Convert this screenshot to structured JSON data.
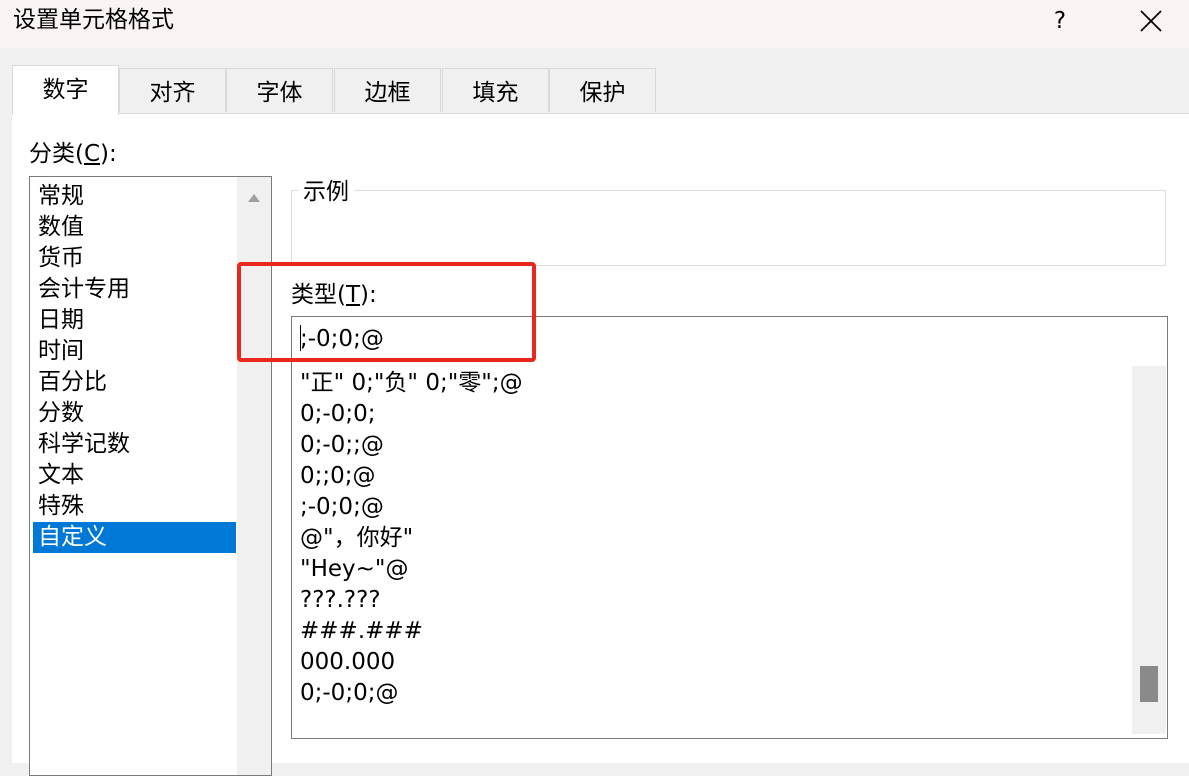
{
  "dialog": {
    "title": "设置单元格格式",
    "help_label": "?"
  },
  "tabs": [
    {
      "label": "数字",
      "active": true
    },
    {
      "label": "对齐",
      "active": false
    },
    {
      "label": "字体",
      "active": false
    },
    {
      "label": "边框",
      "active": false
    },
    {
      "label": "填充",
      "active": false
    },
    {
      "label": "保护",
      "active": false
    }
  ],
  "category": {
    "label_main": "分类(",
    "label_key": "C",
    "label_tail": "):",
    "items": [
      "常规",
      "数值",
      "货币",
      "会计专用",
      "日期",
      "时间",
      "百分比",
      "分数",
      "科学记数",
      "文本",
      "特殊",
      "自定义"
    ],
    "selected": "自定义"
  },
  "sample": {
    "title": "示例"
  },
  "type": {
    "label_main": "类型(",
    "label_key": "T",
    "label_tail": "):",
    "value": ";-0;0;@"
  },
  "formats": [
    "\"正\" 0;\"负\" 0;\"零\";@",
    "0;-0;0;",
    "0;-0;;@",
    "0;;0;@",
    ";-0;0;@",
    "@\"，你好\"",
    "\"Hey~\"@",
    "???.???",
    "###.###",
    "000.000",
    "0;-0;0;@"
  ],
  "colors": {
    "selection": "#0078d7",
    "highlight": "#e8281e"
  }
}
